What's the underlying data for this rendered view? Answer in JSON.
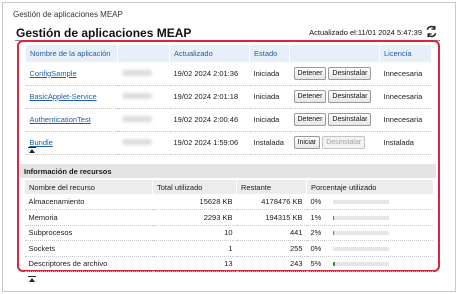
{
  "breadcrumb": "Gestión de aplicaciones MEAP",
  "page_title": "Gestión de aplicaciones MEAP",
  "updated": "Actualizado el:11/01 2024 5:47:39",
  "app_table": {
    "headers": {
      "name": "Nombre de la aplicación",
      "updated": "Actualizado",
      "status": "Estado",
      "license": "Licencia"
    },
    "rows": [
      {
        "name": "ConfigSample",
        "date": "19/02 2024 2:01:36",
        "status": "Iniciada",
        "btn1": "Detener",
        "btn2": "Desinstalar",
        "btn2_enabled": true,
        "license": "Innecesaria"
      },
      {
        "name": "BasicApplet-Service",
        "date": "19/02 2024 2:01:18",
        "status": "Iniciada",
        "btn1": "Detener",
        "btn2": "Desinstalar",
        "btn2_enabled": true,
        "license": "Innecesaria"
      },
      {
        "name": "AuthenticationTest",
        "date": "19/02 2024 2:00:46",
        "status": "Iniciada",
        "btn1": "Detener",
        "btn2": "Desinstalar",
        "btn2_enabled": true,
        "license": "Innecesaria"
      },
      {
        "name": "Bundle",
        "date": "19/02 2024 1:59:06",
        "status": "Instalada",
        "btn1": "Iniciar",
        "btn2": "Desinstalar",
        "btn2_enabled": false,
        "license": "Instalada"
      }
    ]
  },
  "resources": {
    "section_title": "Información de recursos",
    "headers": {
      "name": "Nombre del recurso",
      "used": "Total utilizado",
      "remaining": "Restante",
      "percent": "Porcentaje utilizado"
    },
    "rows": [
      {
        "name": "Almacenamiento",
        "used": "15628 KB",
        "remaining": "4178476 KB",
        "percent": "0%",
        "fill": 0.0
      },
      {
        "name": "Memoria",
        "used": "2293 KB",
        "remaining": "194315 KB",
        "percent": "1%",
        "fill": 0.01
      },
      {
        "name": "Subprocesos",
        "used": "10",
        "remaining": "441",
        "percent": "2%",
        "fill": 0.02
      },
      {
        "name": "Sockets",
        "used": "1",
        "remaining": "255",
        "percent": "0%",
        "fill": 0.0
      },
      {
        "name": "Descriptores de archivo",
        "used": "13",
        "remaining": "243",
        "percent": "5%",
        "fill": 0.05
      }
    ]
  },
  "colors": {
    "accent": "#1f5ea8",
    "highlight": "#d7263d",
    "bar": "#2f9e44"
  },
  "icons": {
    "refresh": "refresh-icon",
    "collapse": "collapse-up-icon"
  }
}
